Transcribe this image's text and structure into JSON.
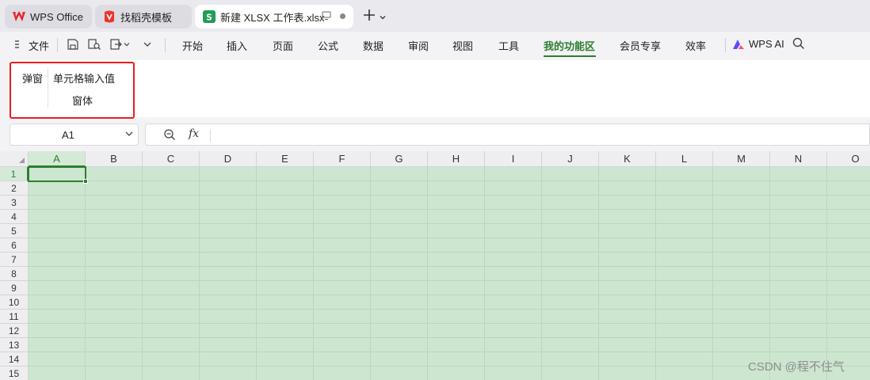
{
  "tabs": [
    {
      "label": "WPS Office",
      "icon": "wps-logo-icon"
    },
    {
      "label": "找稻壳模板",
      "icon": "docer-logo-icon"
    },
    {
      "label": "新建 XLSX 工作表.xlsx",
      "icon": "spreadsheet-s-icon"
    }
  ],
  "menu": {
    "file": "文件",
    "items": [
      "开始",
      "插入",
      "页面",
      "公式",
      "数据",
      "审阅",
      "视图",
      "工具",
      "我的功能区",
      "会员专享",
      "效率"
    ],
    "active": "我的功能区",
    "wps_ai": "WPS AI"
  },
  "ribbon": {
    "popup": "弹窗",
    "cell_input_line1": "单元格输入值",
    "cell_input_line2": "窗体"
  },
  "formula": {
    "name_box": "A1",
    "fx": "fx"
  },
  "columns": [
    "A",
    "B",
    "C",
    "D",
    "E",
    "F",
    "G",
    "H",
    "I",
    "J",
    "K",
    "L",
    "M",
    "N",
    "O"
  ],
  "rows": [
    "1",
    "2",
    "3",
    "4",
    "5",
    "6",
    "7",
    "8",
    "9",
    "10",
    "11",
    "12",
    "13",
    "14",
    "15"
  ],
  "selection": {
    "column": "A",
    "row": "1"
  },
  "colors": {
    "accent": "#2e7d32",
    "grid_bg": "#cde6cf",
    "highlight": "#ef1b1b"
  },
  "watermark": "CSDN @程不住气"
}
